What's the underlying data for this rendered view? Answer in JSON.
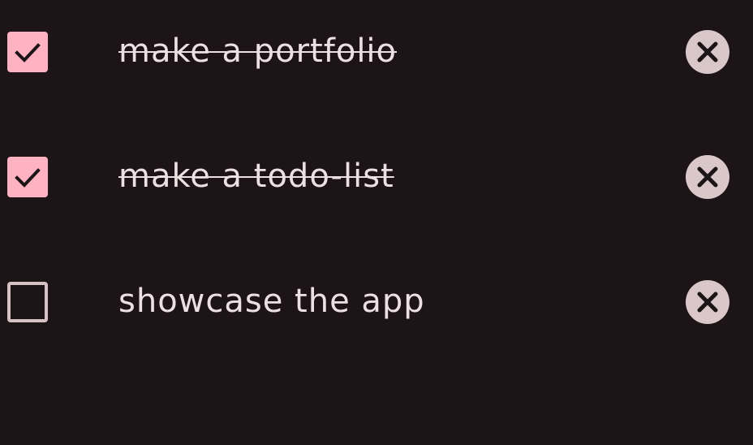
{
  "colors": {
    "background": "#1c1416",
    "checkbox_checked": "#ffb2c1",
    "checkbox_unchecked_border": "#d6c2c5",
    "text": "#ece0e2",
    "delete_button": "#d9c7ca",
    "icon_dark": "#1c1416"
  },
  "todos": [
    {
      "text": "make a portfolio",
      "checked": true,
      "delete_icon": "close-icon",
      "check_icon": "check-icon"
    },
    {
      "text": "make a todo-list",
      "checked": true,
      "delete_icon": "close-icon",
      "check_icon": "check-icon"
    },
    {
      "text": "showcase the app",
      "checked": false,
      "delete_icon": "close-icon",
      "check_icon": ""
    }
  ]
}
